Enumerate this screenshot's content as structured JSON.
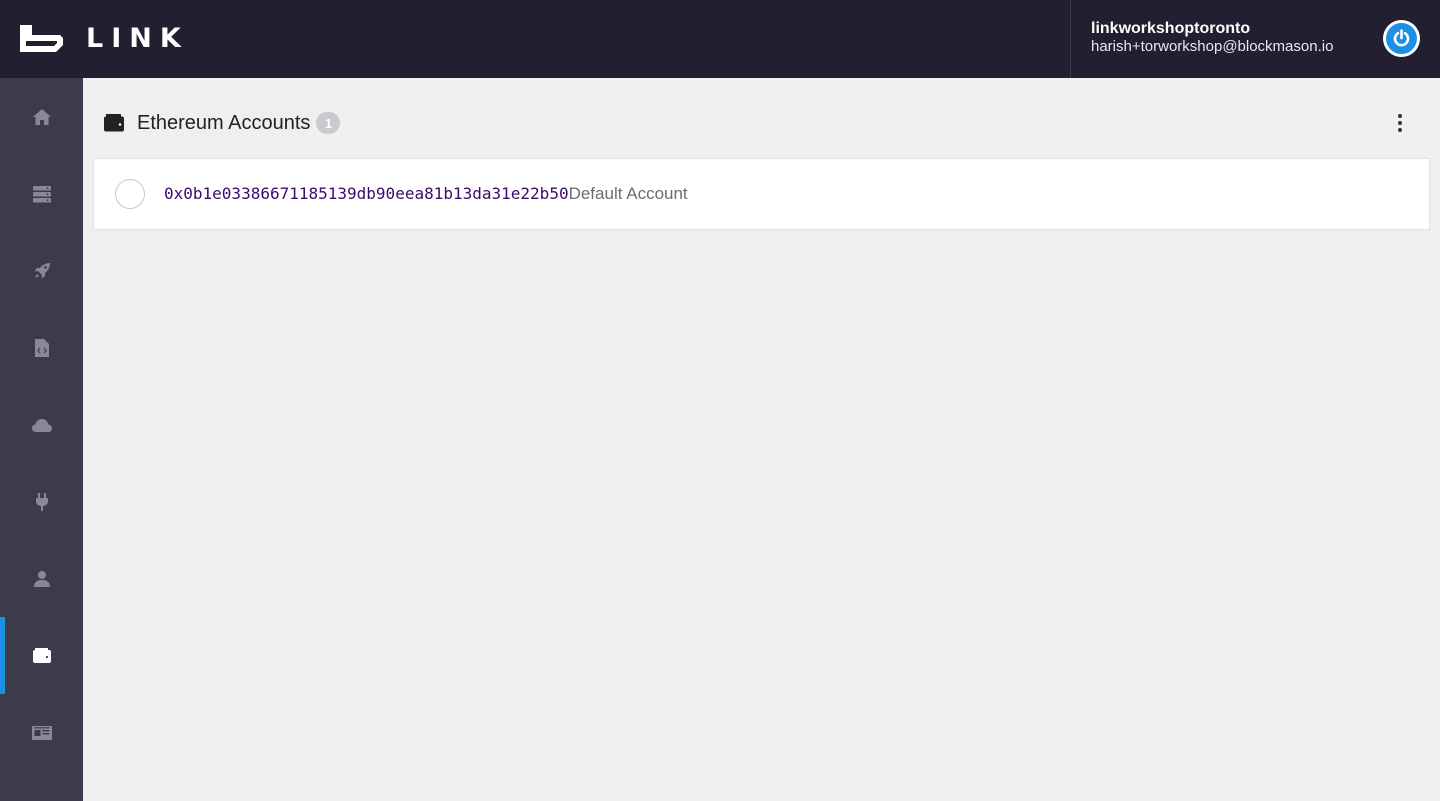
{
  "app": {
    "logo_text": "LINK",
    "accent_color": "#1e8fe6",
    "topbar_color": "#211f30",
    "sidebar_color": "#3d3a4c"
  },
  "user": {
    "name": "linkworkshoptoronto",
    "email": "harish+torworkshop@blockmason.io",
    "power_icon": "power-icon"
  },
  "sidebar": {
    "items": [
      {
        "icon": "home-icon",
        "active": false
      },
      {
        "icon": "server-icon",
        "active": false
      },
      {
        "icon": "rocket-icon",
        "active": false
      },
      {
        "icon": "code-file-icon",
        "active": false
      },
      {
        "icon": "cloud-icon",
        "active": false
      },
      {
        "icon": "plug-icon",
        "active": false
      },
      {
        "icon": "user-icon",
        "active": false
      },
      {
        "icon": "wallet-icon",
        "active": true
      },
      {
        "icon": "id-card-icon",
        "active": false
      }
    ]
  },
  "section": {
    "title": "Ethereum Accounts",
    "count": "1",
    "icon": "wallet-icon",
    "menu_icon": "more-vertical-icon"
  },
  "accounts": [
    {
      "address": "0x0b1e03386671185139db90eea81b13da31e22b50",
      "label": "Default Account",
      "selected": false
    }
  ]
}
